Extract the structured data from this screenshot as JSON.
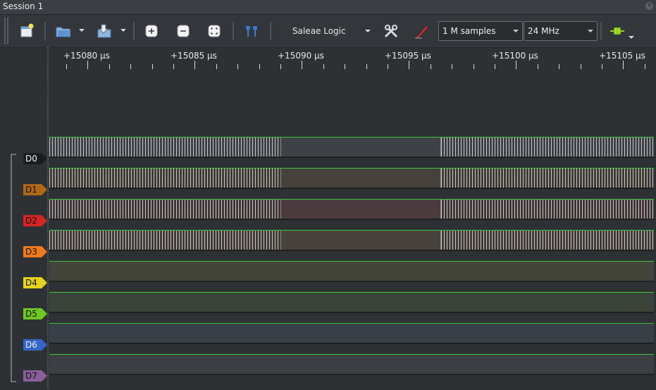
{
  "window": {
    "title": "Session 1"
  },
  "toolbar": {
    "device": "Saleae Logic",
    "samples": "1 M samples",
    "rate": "24 MHz",
    "icons": [
      "new-session-icon",
      "open-icon",
      "save-icon",
      "zoom-in-icon",
      "zoom-out-icon",
      "zoom-fit-icon",
      "markers-icon",
      "settings-icon",
      "trigger-icon",
      "analyzer-icon"
    ]
  },
  "ruler": {
    "labels": [
      "+15080 µs",
      "+15085 µs",
      "+15090 µs",
      "+15095 µs",
      "+15100 µs",
      "+15105 µs"
    ]
  },
  "channels": [
    {
      "label": "D0",
      "color": "#1b1d1f",
      "text": "#f2f2f2",
      "tint": "#3c4046",
      "idle_tint": "#3e4247",
      "activity": "toggling"
    },
    {
      "label": "D1",
      "color": "#b06818",
      "text": "#111111",
      "tint": "#3e3a34",
      "idle_tint": "#46423b",
      "activity": "toggling"
    },
    {
      "label": "D2",
      "color": "#d42525",
      "text": "#111111",
      "tint": "#3f3536",
      "idle_tint": "#4a3b3e",
      "activity": "toggling"
    },
    {
      "label": "D3",
      "color": "#f07a1a",
      "text": "#111111",
      "tint": "#3f3a35",
      "idle_tint": "#48423c",
      "activity": "toggling"
    },
    {
      "label": "D4",
      "color": "#e6d21a",
      "text": "#111111",
      "tint": "#434539",
      "idle_tint": "#434539",
      "activity": "high"
    },
    {
      "label": "D5",
      "color": "#6dc81f",
      "text": "#111111",
      "tint": "#3c4439",
      "idle_tint": "#3c4439",
      "activity": "high"
    },
    {
      "label": "D6",
      "color": "#3366c8",
      "text": "#f2f2f2",
      "tint": "#393f47",
      "idle_tint": "#393f47",
      "activity": "high"
    },
    {
      "label": "D7",
      "color": "#8a5e9a",
      "text": "#111111",
      "tint": "#3e3f45",
      "idle_tint": "#3e3f45",
      "activity": "high"
    }
  ]
}
